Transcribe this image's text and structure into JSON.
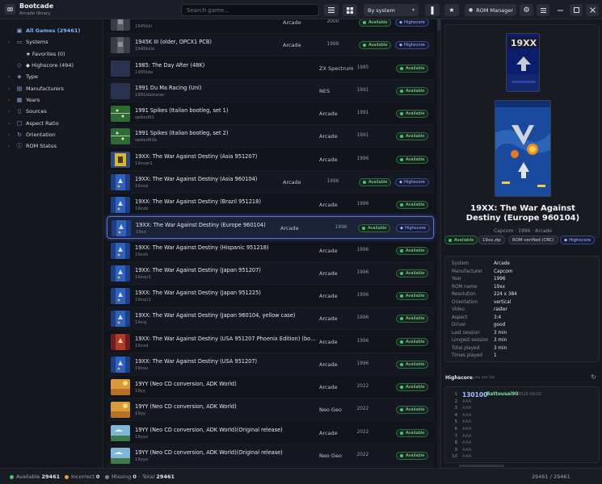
{
  "app": {
    "title": "Bootcade",
    "subtitle": "Arcade library"
  },
  "toolbar": {
    "search_placeholder": "Search game...",
    "sort_value": "By system",
    "rom_manager_label": "ROM Manager"
  },
  "sidebar": {
    "items": [
      {
        "label": "All Games (29461)",
        "icon": "gamepad-icon",
        "active": true,
        "chevron": false
      },
      {
        "label": "Systems",
        "icon": "monitor-icon",
        "chevron": true
      },
      {
        "label": "★ Favorites (0)",
        "icon": "",
        "chevron": false,
        "sub": true
      },
      {
        "label": "◆ Highscore (494)",
        "icon": "diamond-outline-icon",
        "chevron": false,
        "sub": true
      },
      {
        "label": "Type",
        "icon": "tag-icon",
        "chevron": true
      },
      {
        "label": "Manufacturers",
        "icon": "building-icon",
        "chevron": true
      },
      {
        "label": "Years",
        "icon": "calendar-icon",
        "chevron": true
      },
      {
        "label": "Sources",
        "icon": "document-icon",
        "chevron": true
      },
      {
        "label": "Aspect Ratio",
        "icon": "aspect-ratio-icon",
        "chevron": true
      },
      {
        "label": "Orientation",
        "icon": "rotate-icon",
        "chevron": true
      },
      {
        "label": "ROM Status",
        "icon": "info-icon",
        "chevron": true
      }
    ]
  },
  "games": [
    {
      "name": "",
      "id": "1945kiii",
      "system": "Arcade",
      "year": "2000",
      "available": "Available",
      "highscore": "Highscore",
      "thumb": "gray"
    },
    {
      "name": "1945K III (older, OPCX1 PCB)",
      "id": "1945kiiio",
      "system": "Arcade",
      "year": "1999",
      "available": "Available",
      "highscore": "Highscore",
      "thumb": "gray"
    },
    {
      "name": "1985: The Day After (48K)",
      "id": "1985tda",
      "system": "ZX Spectrum",
      "year": "1985",
      "available": "Available",
      "highscore": "",
      "thumb": "blank"
    },
    {
      "name": "1991 Du Ma Racing (Unl)",
      "id": "1991dumarac",
      "system": "NES",
      "year": "1991",
      "available": "Available",
      "highscore": "",
      "thumb": "blank"
    },
    {
      "name": "1991 Spikes (Italian bootleg, set 1)",
      "id": "spiked91",
      "system": "Arcade",
      "year": "1991",
      "available": "Available",
      "highscore": "",
      "thumb": "field"
    },
    {
      "name": "1991 Spikes (Italian bootleg, set 2)",
      "id": "spiked91b",
      "system": "Arcade",
      "year": "1991",
      "available": "Available",
      "highscore": "",
      "thumb": "field"
    },
    {
      "name": "19XX: The War Against Destiny (Asia 951207)",
      "id": "19xxar1",
      "system": "Arcade",
      "year": "1996",
      "available": "Available",
      "highscore": "",
      "thumb": "yellow"
    },
    {
      "name": "19XX: The War Against Destiny (Asia 960104)",
      "id": "19xxa",
      "system": "Arcade",
      "year": "1996",
      "available": "Available",
      "highscore": "Highscore",
      "thumb": "blue"
    },
    {
      "name": "19XX: The War Against Destiny (Brazil 951218)",
      "id": "19xxb",
      "system": "Arcade",
      "year": "1996",
      "available": "Available",
      "highscore": "",
      "thumb": "blue"
    },
    {
      "name": "19XX: The War Against Destiny (Europe 960104)",
      "id": "19xx",
      "system": "Arcade",
      "year": "1996",
      "available": "Available",
      "highscore": "Highscore",
      "thumb": "blue",
      "selected": true
    },
    {
      "name": "19XX: The War Against Destiny (Hispanic 951218)",
      "id": "19xxh",
      "system": "Arcade",
      "year": "1996",
      "available": "Available",
      "highscore": "",
      "thumb": "blue"
    },
    {
      "name": "19XX: The War Against Destiny (Japan 951207)",
      "id": "19xxjr2",
      "system": "Arcade",
      "year": "1996",
      "available": "Available",
      "highscore": "",
      "thumb": "blue"
    },
    {
      "name": "19XX: The War Against Destiny (Japan 951225)",
      "id": "19xxjr1",
      "system": "Arcade",
      "year": "1996",
      "available": "Available",
      "highscore": "",
      "thumb": "blue"
    },
    {
      "name": "19XX: The War Against Destiny (Japan 960104, yellow case)",
      "id": "19xxj",
      "system": "Arcade",
      "year": "1996",
      "available": "Available",
      "highscore": "",
      "thumb": "blue"
    },
    {
      "name": "19XX: The War Against Destiny (USA 951207 Phoenix Edition) (boo...",
      "id": "19xxd",
      "system": "Arcade",
      "year": "1996",
      "available": "Available",
      "highscore": "",
      "thumb": "red"
    },
    {
      "name": "19XX: The War Against Destiny (USA 951207)",
      "id": "19xxu",
      "system": "Arcade",
      "year": "1996",
      "available": "Available",
      "highscore": "",
      "thumb": "blue"
    },
    {
      "name": "19YY (Neo CD conversion, ADK World)",
      "id": "19yy",
      "system": "Arcade",
      "year": "2022",
      "available": "Available",
      "highscore": "",
      "thumb": "orange"
    },
    {
      "name": "19YY (Neo CD conversion, ADK World)",
      "id": "19yy",
      "system": "Neo Geo",
      "year": "2022",
      "available": "Available",
      "highscore": "",
      "thumb": "orange"
    },
    {
      "name": "19YY (Neo CD conversion, ADK World)(Original release)",
      "id": "19yyo",
      "system": "Arcade",
      "year": "2022",
      "available": "Available",
      "highscore": "",
      "thumb": "sky"
    },
    {
      "name": "19YY (Neo CD conversion, ADK World)(Original release)",
      "id": "19yyo",
      "system": "Neo Geo",
      "year": "2022",
      "available": "Available",
      "highscore": "",
      "thumb": "sky"
    }
  ],
  "detail": {
    "title": "19XX: The War Against Destiny (Europe 960104)",
    "meta": "Capcom  ·  1996  ·  Arcade",
    "chips": {
      "available": "Available",
      "zip": "19xx.zip",
      "rom": "ROM verified (CRC)",
      "highscore": "Highscore"
    },
    "art_text": "19XX",
    "specs": [
      {
        "k": "System",
        "v": "Arcade"
      },
      {
        "k": "Manufacturer",
        "v": "Capcom"
      },
      {
        "k": "Year",
        "v": "1996"
      },
      {
        "k": "ROM name",
        "v": "19xx"
      },
      {
        "k": "Resolution",
        "v": "224 x 384"
      },
      {
        "k": "Orientation",
        "v": "vertical"
      },
      {
        "k": "Video",
        "v": "raster"
      },
      {
        "k": "Aspect",
        "v": "3:4"
      },
      {
        "k": "Driver",
        "v": "good"
      },
      {
        "k": "Last session",
        "v": "3 min"
      },
      {
        "k": "Longest session",
        "v": "3 min"
      },
      {
        "k": "Total played",
        "v": "3 min"
      },
      {
        "k": "Times played",
        "v": "1"
      }
    ],
    "highscore": {
      "title": "Highscore",
      "subtitle": "you are 1st",
      "entries": [
        {
          "rank": "1",
          "score": "130100",
          "player": "Battousai90",
          "date": "2026-09-02"
        },
        {
          "rank": "2",
          "score": "",
          "player": "AAA",
          "date": ""
        },
        {
          "rank": "3",
          "score": "",
          "player": "AAA",
          "date": ""
        },
        {
          "rank": "4",
          "score": "",
          "player": "AAA",
          "date": ""
        },
        {
          "rank": "5",
          "score": "",
          "player": "AAA",
          "date": ""
        },
        {
          "rank": "6",
          "score": "",
          "player": "AAA",
          "date": ""
        },
        {
          "rank": "7",
          "score": "",
          "player": "AAA",
          "date": ""
        },
        {
          "rank": "8",
          "score": "",
          "player": "AAA",
          "date": ""
        },
        {
          "rank": "9",
          "score": "",
          "player": "AAA",
          "date": ""
        },
        {
          "rank": "10",
          "score": "",
          "player": "AAA",
          "date": ""
        }
      ]
    }
  },
  "status": {
    "available_label": "Available",
    "available_count": "29461",
    "incorrect_label": "Incorrect",
    "incorrect_count": "0",
    "missing_label": "Missing",
    "missing_count": "0",
    "total_label": "· Total",
    "total_count": "29461",
    "right_count": "29461",
    "right_total": "/ 29461",
    "colors": {
      "available": "#3fcf72",
      "incorrect": "#e0a23a",
      "missing": "#7a808a"
    }
  },
  "colors": {
    "accent": "#7fb0ff",
    "selection_border": "#5c6ed8",
    "available_green": "#3fcf72"
  }
}
